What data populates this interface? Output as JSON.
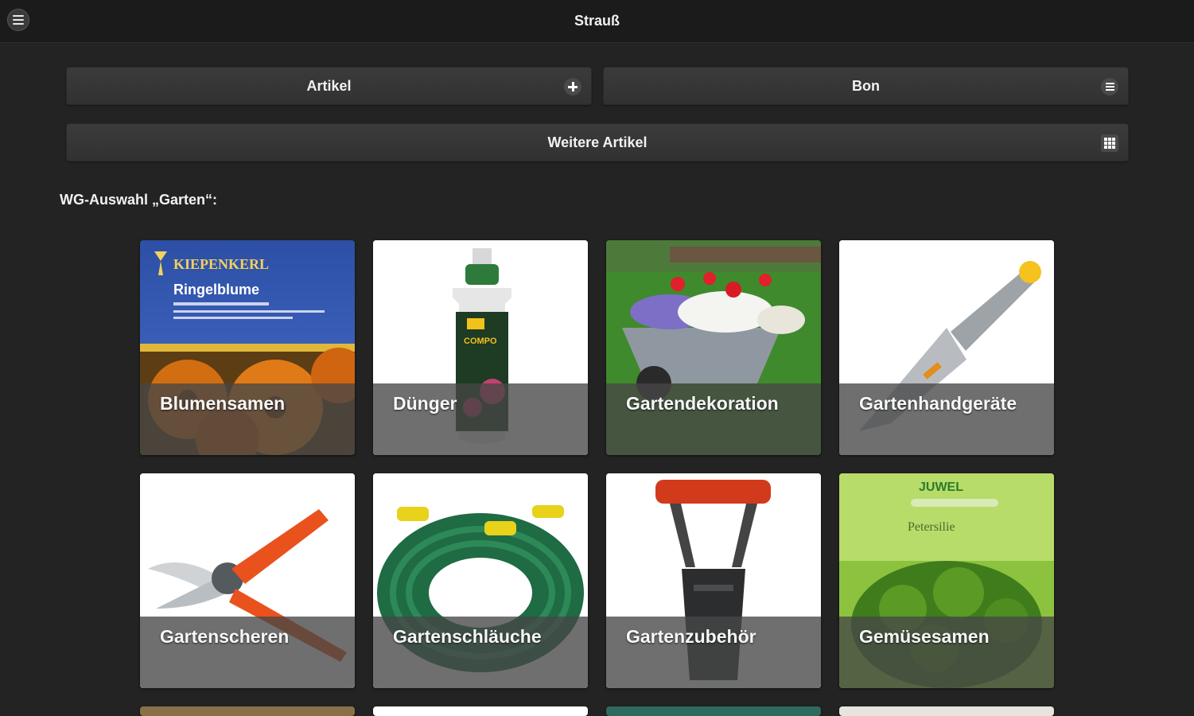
{
  "header": {
    "title": "Strauß",
    "menu_icon": "menu-icon"
  },
  "buttons": {
    "artikel": {
      "label": "Artikel",
      "icon": "plus-icon"
    },
    "bon": {
      "label": "Bon",
      "icon": "list-icon"
    },
    "weitere": {
      "label": "Weitere Artikel",
      "icon": "grid-icon"
    }
  },
  "section": {
    "label": "WG-Auswahl „Garten“:"
  },
  "tiles": [
    {
      "label": "Blumensamen"
    },
    {
      "label": "Dünger"
    },
    {
      "label": "Gartendekoration"
    },
    {
      "label": "Gartenhandgeräte"
    },
    {
      "label": "Gartenscheren"
    },
    {
      "label": "Gartenschläuche"
    },
    {
      "label": "Gartenzubehör"
    },
    {
      "label": "Gemüsesamen"
    }
  ],
  "product_text": {
    "seed_brand": "KIEPENKERL",
    "seed_name": "Ringelblume",
    "fert_brand": "COMPO",
    "veg_brand": "JUWEL",
    "veg_name": "Petersilie"
  }
}
